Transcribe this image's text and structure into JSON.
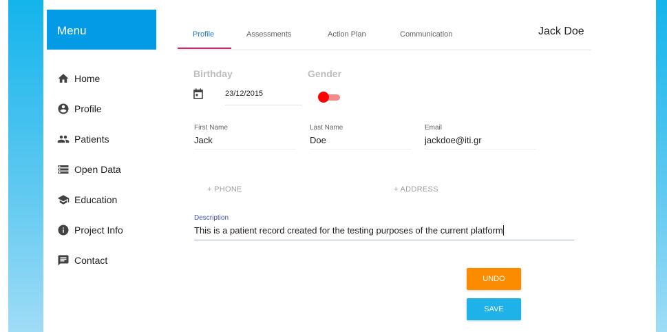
{
  "sidebar": {
    "title": "Menu",
    "items": [
      {
        "label": "Home",
        "icon": "home-icon"
      },
      {
        "label": "Profile",
        "icon": "account-circle-icon"
      },
      {
        "label": "Patients",
        "icon": "people-icon"
      },
      {
        "label": "Open Data",
        "icon": "storage-icon"
      },
      {
        "label": "Education",
        "icon": "school-icon"
      },
      {
        "label": "Project Info",
        "icon": "info-icon"
      },
      {
        "label": "Contact",
        "icon": "chat-icon"
      }
    ]
  },
  "tabs": [
    {
      "label": "Profile",
      "active": true
    },
    {
      "label": "Assessments",
      "active": false
    },
    {
      "label": "Action Plan",
      "active": false
    },
    {
      "label": "Communication",
      "active": false
    }
  ],
  "user_name": "Jack Doe",
  "form": {
    "birthday_label": "Birthday",
    "birthday_value": "23/12/2015",
    "gender_label": "Gender",
    "gender_toggle_on": true,
    "first_name_label": "First Name",
    "first_name_value": "Jack",
    "last_name_label": "Last Name",
    "last_name_value": "Doe",
    "email_label": "Email",
    "email_value": "jackdoe@iti.gr",
    "add_phone_label": "+ PHONE",
    "add_address_label": "+ ADDRESS",
    "description_label": "Description",
    "description_value": "This is a patient record created for the testing purposes of the current platform"
  },
  "actions": {
    "undo_label": "UNDO",
    "save_label": "SAVE"
  },
  "colors": {
    "menu_header": "#039be5",
    "active_tab_ink": "#e91e63",
    "toggle_thumb": "#ff0000",
    "undo": "#fb8c00",
    "save": "#1fb2e8"
  }
}
